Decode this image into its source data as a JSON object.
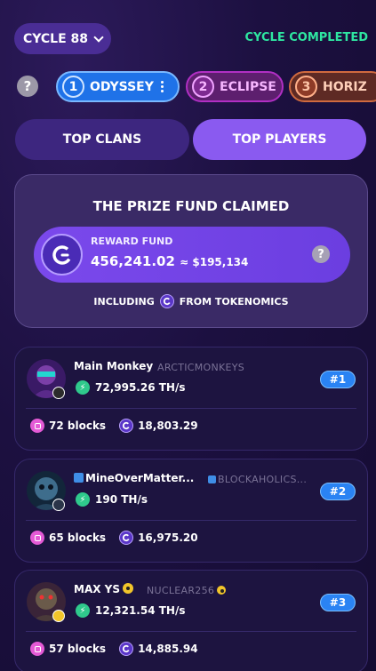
{
  "header": {
    "cycle_label": "CYCLE 88",
    "cycle_status": "CYCLE COMPLETED",
    "status_color": "#2ee6a1"
  },
  "arenas": [
    {
      "num": "1",
      "name": "ODYSSEY",
      "color": "#1f72e8"
    },
    {
      "num": "2",
      "name": "ECLIPSE",
      "color": "#5d1f6e"
    },
    {
      "num": "3",
      "name": "HORIZ",
      "color": "#5e2a24"
    }
  ],
  "help_glyph": "?",
  "tabs": {
    "clans": "TOP CLANS",
    "players": "TOP PLAYERS",
    "active": "players"
  },
  "prize": {
    "title": "THE PRIZE FUND CLAIMED",
    "reward_label": "REWARD FUND",
    "reward_value": "456,241.02",
    "reward_usd": "≈ $195,134",
    "including_prefix": "INCLUDING",
    "including_suffix": "FROM TOKENOMICS"
  },
  "players": [
    {
      "name": "Main Monkey",
      "clan": "ARCTICMONKEYS",
      "hashrate": "72,995.26 TH/s",
      "rank": "#1",
      "blocks": "72 blocks",
      "reward": "18,803.29"
    },
    {
      "name": "MineOverMatter...",
      "clan": "BLOCKAHOLICS...",
      "hashrate": "190 TH/s",
      "rank": "#2",
      "blocks": "65 blocks",
      "reward": "16,975.20"
    },
    {
      "name": "MAX YS",
      "clan": "NUCLEAR256",
      "hashrate": "12,321.54 TH/s",
      "rank": "#3",
      "blocks": "57 blocks",
      "reward": "14,885.94"
    }
  ]
}
